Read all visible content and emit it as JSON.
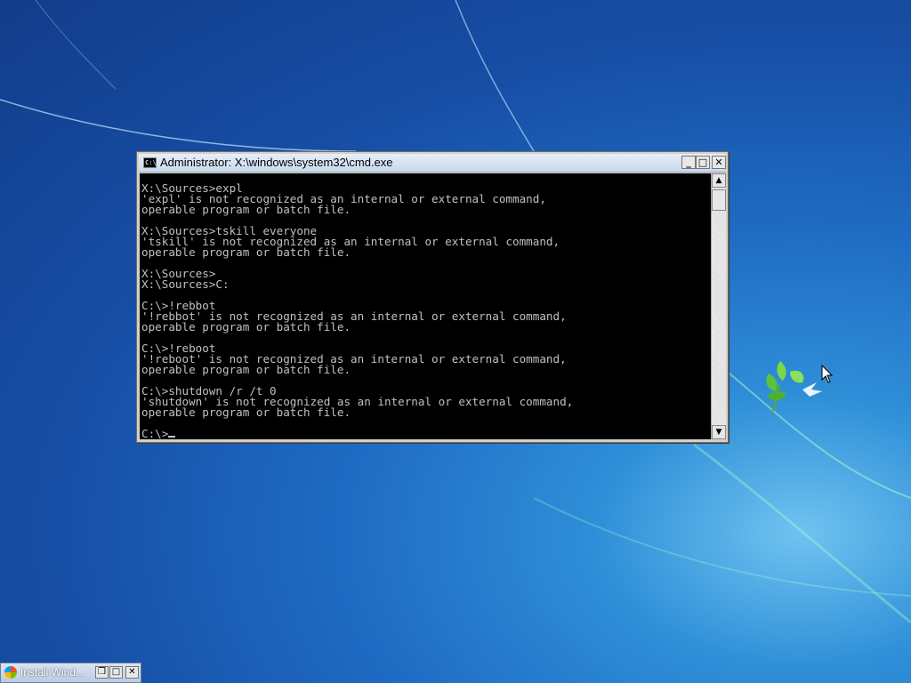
{
  "desktop": {
    "logo_icon": "windows-leaf-bird-logo",
    "colors": {
      "background": "#1f6cc4",
      "glow": "#6fc3f0"
    }
  },
  "cmd_window": {
    "title": "Administrator: X:\\windows\\system32\\cmd.exe",
    "icon": "cmd-icon",
    "buttons": {
      "minimize": "_",
      "maximize": "□",
      "close": "✕"
    },
    "console_lines": [
      "X:\\Sources>expl",
      "'expl' is not recognized as an internal or external command,",
      "operable program or batch file.",
      "",
      "X:\\Sources>tskill everyone",
      "'tskill' is not recognized as an internal or external command,",
      "operable program or batch file.",
      "",
      "X:\\Sources>",
      "X:\\Sources>C:",
      "",
      "C:\\>!rebbot",
      "'!rebbot' is not recognized as an internal or external command,",
      "operable program or batch file.",
      "",
      "C:\\>!reboot",
      "'!reboot' is not recognized as an internal or external command,",
      "operable program or batch file.",
      "",
      "C:\\>shutdown /r /t 0",
      "'shutdown' is not recognized as an internal or external command,",
      "operable program or batch file.",
      ""
    ],
    "prompt": "C:\\>",
    "scroll": {
      "up": "▲",
      "down": "▼"
    }
  },
  "minimized_window": {
    "title": "Install Wind...",
    "buttons": {
      "restore": "❐",
      "maximize": "□",
      "close": "✕"
    }
  }
}
